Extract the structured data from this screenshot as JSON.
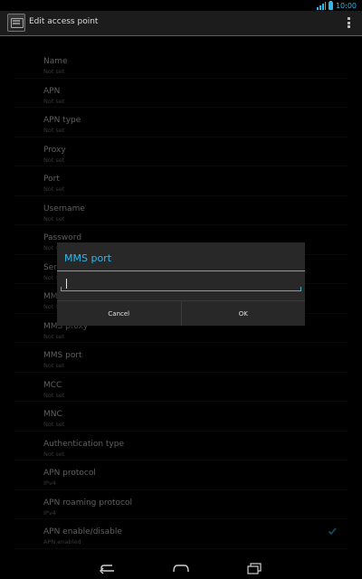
{
  "status_bar": {
    "time": "10:00",
    "accent": "#33b5e5"
  },
  "action_bar": {
    "title": "Edit access point",
    "icon": "apn-settings-icon",
    "menu_icon": "overflow-menu-icon"
  },
  "settings": [
    {
      "title": "Name",
      "summary": "Not set"
    },
    {
      "title": "APN",
      "summary": "Not set"
    },
    {
      "title": "APN type",
      "summary": "Not set"
    },
    {
      "title": "Proxy",
      "summary": "Not set"
    },
    {
      "title": "Port",
      "summary": "Not set"
    },
    {
      "title": "Username",
      "summary": "Not set"
    },
    {
      "title": "Password",
      "summary": "Not set"
    },
    {
      "title": "Server",
      "summary": "Not set"
    },
    {
      "title": "MMSC",
      "summary": "Not set"
    },
    {
      "title": "MMS proxy",
      "summary": "Not set"
    },
    {
      "title": "MMS port",
      "summary": "Not set"
    },
    {
      "title": "MCC",
      "summary": "Not set"
    },
    {
      "title": "MNC",
      "summary": "Not set"
    },
    {
      "title": "Authentication type",
      "summary": "Not set"
    },
    {
      "title": "APN protocol",
      "summary": "IPv4"
    },
    {
      "title": "APN roaming protocol",
      "summary": "IPv4"
    },
    {
      "title": "APN enable/disable",
      "summary": "APN enabled",
      "checked": true
    }
  ],
  "dialog": {
    "title": "MMS port",
    "input_value": "",
    "cancel_label": "Cancel",
    "ok_label": "OK"
  },
  "nav_bar": {
    "back_icon": "back-icon",
    "home_icon": "home-icon",
    "recents_icon": "recent-apps-icon"
  }
}
